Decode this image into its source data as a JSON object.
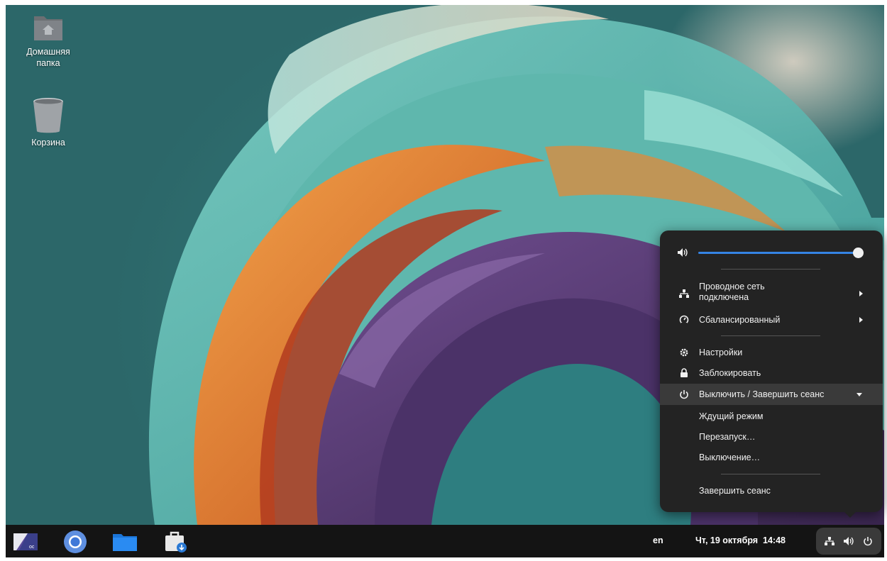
{
  "desktop": {
    "icons": [
      {
        "label": "Домашняя\nпапка",
        "icon": "home-folder-icon"
      },
      {
        "label": "Корзина",
        "icon": "trash-icon"
      }
    ]
  },
  "menu": {
    "volume": {
      "icon": "volume-icon",
      "level": 1.0
    },
    "network": {
      "label": "Проводное сеть",
      "label2": "подключена",
      "icon": "network-wired-icon"
    },
    "power_profile": {
      "label": "Сбалансированный",
      "icon": "power-profile-icon"
    },
    "settings": {
      "label": "Настройки",
      "icon": "gear-icon"
    },
    "lock": {
      "label": "Заблокировать",
      "icon": "lock-icon"
    },
    "power": {
      "label": "Выключить / Завершить сеанс",
      "icon": "power-icon"
    },
    "power_submenu": {
      "suspend": "Ждущий режим",
      "restart": "Перезапуск…",
      "shutdown": "Выключение…",
      "logout": "Завершить сеанс"
    },
    "colors": {
      "accent": "#3584e4",
      "background": "#232323"
    }
  },
  "taskbar": {
    "apps": [
      "app-menu-icon",
      "chromium-icon",
      "files-icon",
      "software-store-icon"
    ],
    "keyboard_layout": "en",
    "clock": "Чт, 19 октября  14:48",
    "tray": [
      "network-icon",
      "volume-icon",
      "power-icon"
    ]
  }
}
